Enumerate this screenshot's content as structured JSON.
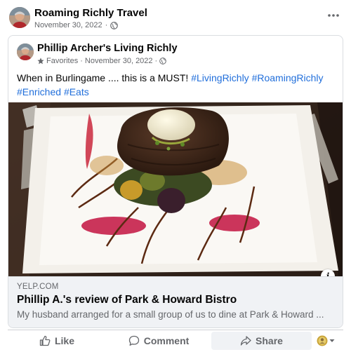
{
  "outer_post": {
    "page_name": "Roaming Richly Travel",
    "date": "November 30, 2022",
    "privacy_icon": "globe-icon",
    "more_icon": "more-horizontal-icon"
  },
  "shared_post": {
    "author": "Phillip Archer's Living Richly",
    "favorites_label": "Favorites",
    "date": "November 30, 2022",
    "separator": "·",
    "caption_text": "When in Burlingame .... this is a MUST! ",
    "hashtags": [
      "#LivingRichly",
      "#RoamingRichly",
      "#Enriched",
      "#Eats"
    ]
  },
  "link_preview": {
    "domain": "YELP.COM",
    "title": "Phillip A.'s review of Park & Howard Bistro",
    "description": "My husband arranged for a small group of us to dine at Park & Howard ...",
    "info_icon": "i"
  },
  "actions": {
    "like": "Like",
    "comment": "Comment",
    "share": "Share"
  },
  "colors": {
    "hashtag": "#216fdb",
    "meta_text": "#65676b",
    "share_button_bg": "#f0f2f5"
  }
}
